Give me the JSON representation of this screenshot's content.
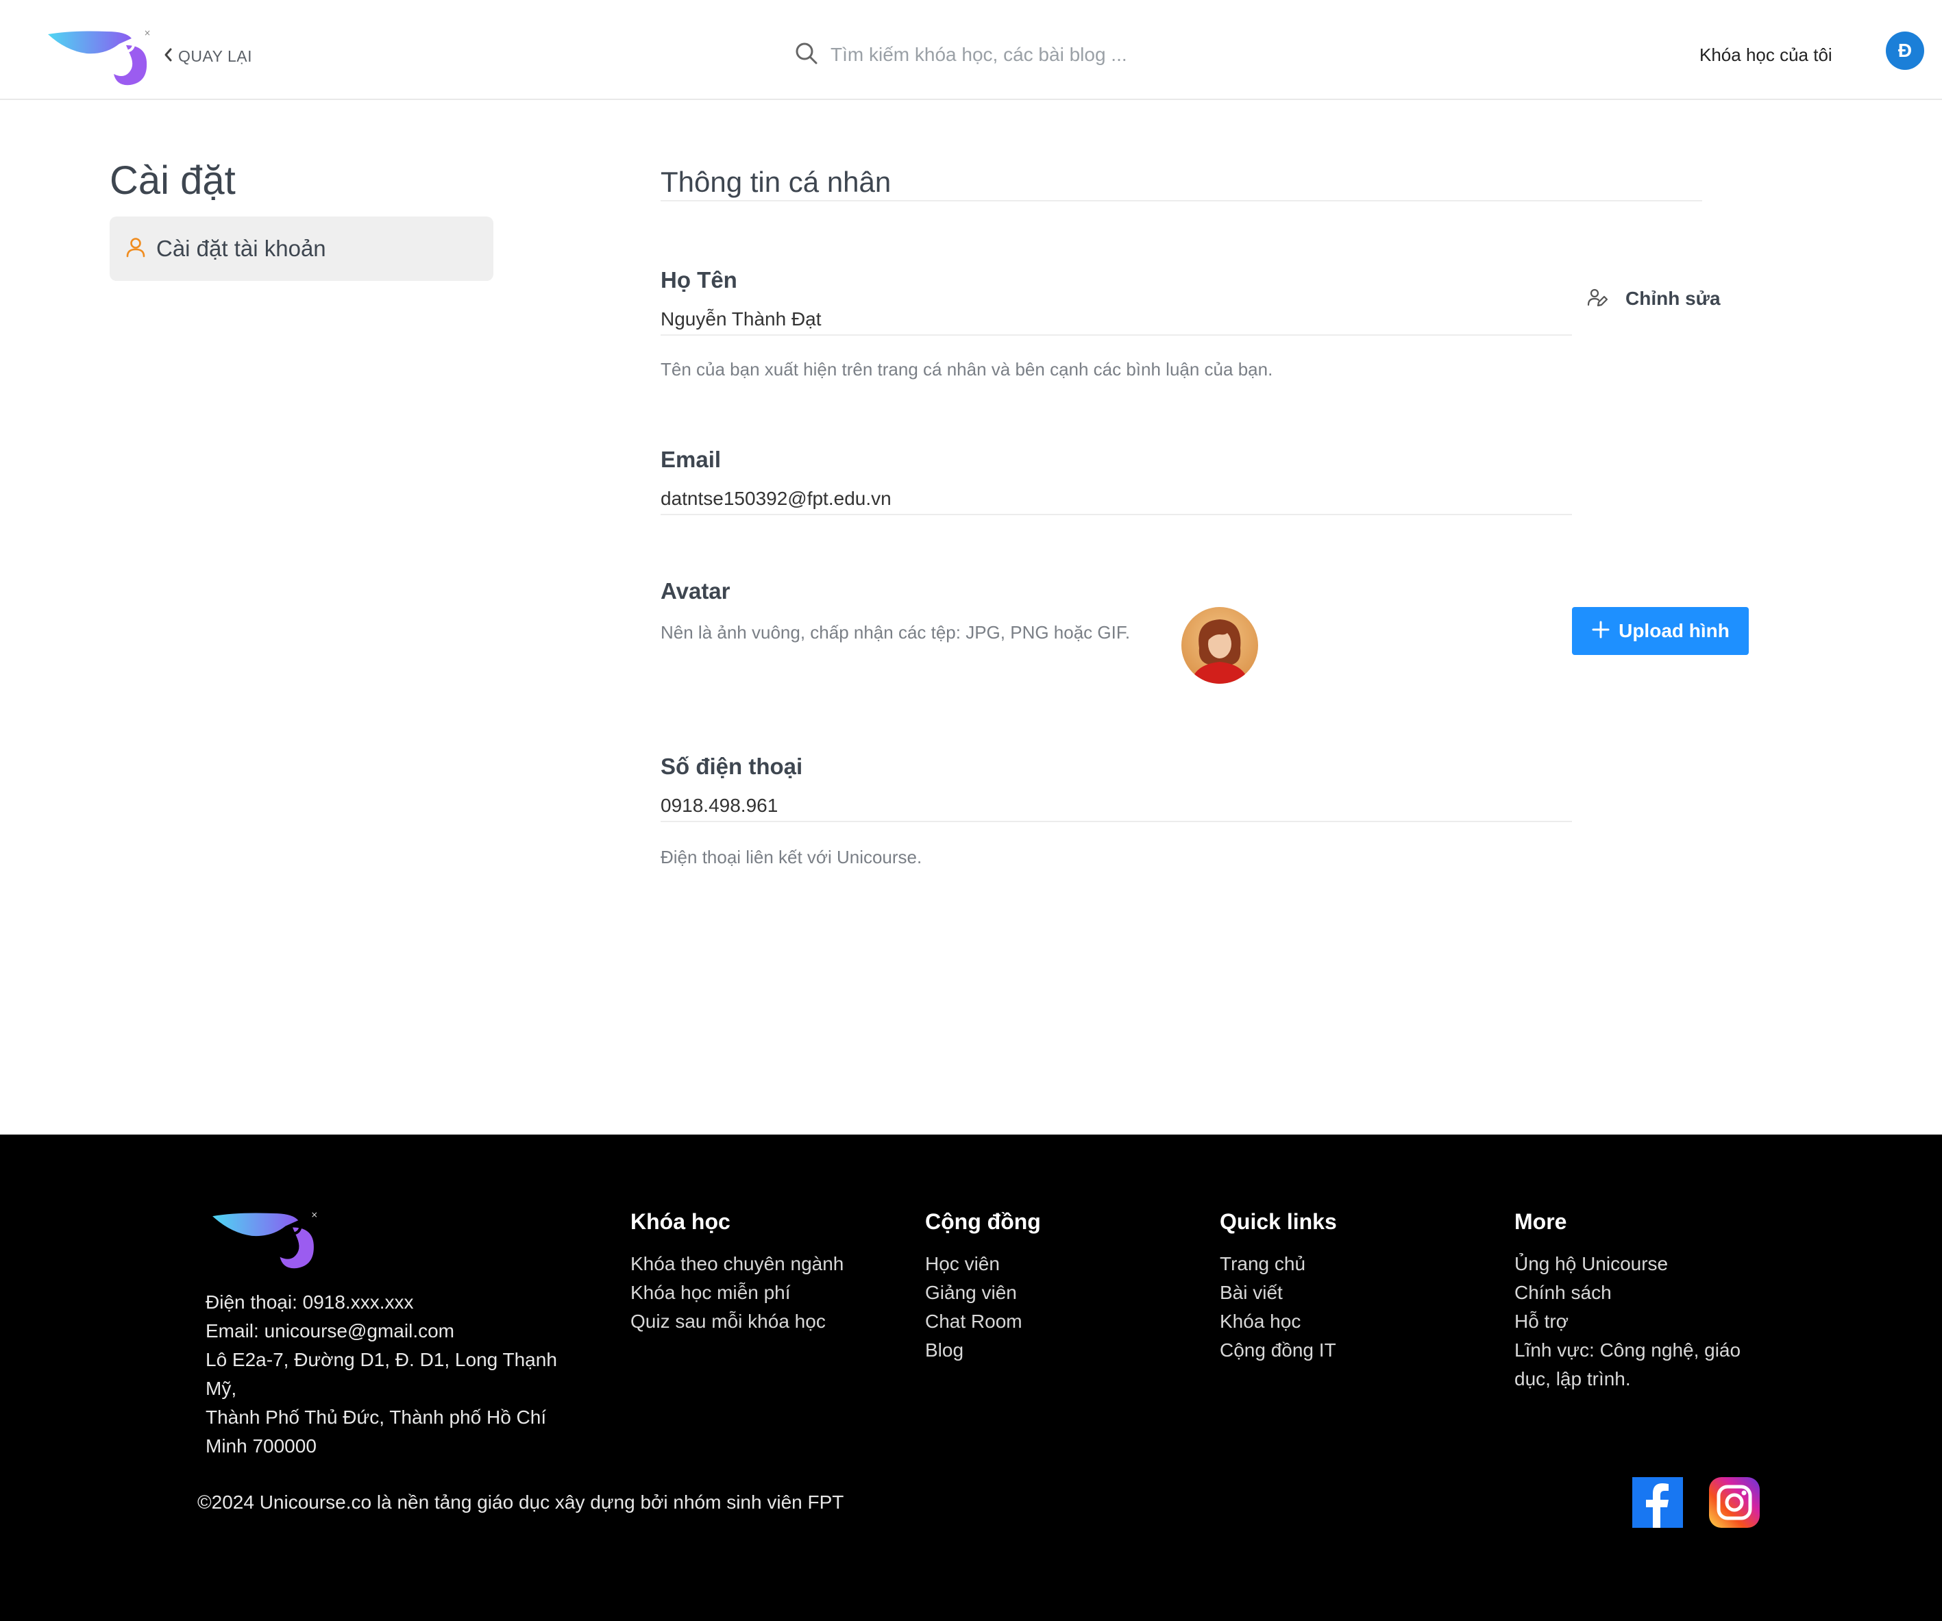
{
  "header": {
    "back_label": "QUAY LẠI",
    "search_placeholder": "Tìm kiếm khóa học, các bài blog ...",
    "my_courses": "Khóa học của tôi",
    "avatar_initial": "Đ"
  },
  "sidebar": {
    "title": "Cài đặt",
    "items": [
      {
        "label": "Cài đặt tài khoản",
        "icon": "user-icon",
        "active": true
      }
    ]
  },
  "main": {
    "section_title": "Thông tin cá nhân",
    "edit_label": "Chỉnh sửa",
    "name": {
      "label": "Họ Tên",
      "value": "Nguyễn Thành Đạt",
      "description": "Tên của bạn xuất hiện trên trang cá nhân và bên cạnh các bình luận của bạn."
    },
    "email": {
      "label": "Email",
      "value": "datntse150392@fpt.edu.vn"
    },
    "avatar": {
      "label": "Avatar",
      "description": "Nên là ảnh vuông, chấp nhận các tệp: JPG, PNG hoặc GIF.",
      "upload_label": "Upload hình"
    },
    "phone": {
      "label": "Số điện thoại",
      "value": "0918.498.961",
      "description": "Điện thoại liên kết với Unicourse."
    }
  },
  "footer": {
    "contact": {
      "phone": "Điện thoại: 0918.xxx.xxx",
      "email": "Email: unicourse@gmail.com",
      "address_lines": [
        "Lô E2a-7, Đường D1, Đ. D1, Long Thạnh Mỹ,",
        "Thành Phố Thủ Đức, Thành phố Hồ Chí",
        "Minh 700000"
      ]
    },
    "columns": [
      {
        "title": "Khóa học",
        "links": [
          "Khóa theo chuyên ngành",
          "Khóa học miễn phí",
          "Quiz sau mỗi khóa học"
        ]
      },
      {
        "title": "Cộng đồng",
        "links": [
          "Học viên",
          "Giảng viên",
          "Chat Room",
          "Blog"
        ]
      },
      {
        "title": "Quick links",
        "links": [
          "Trang chủ",
          "Bài viết",
          "Khóa học",
          "Cộng đồng IT"
        ]
      },
      {
        "title": "More",
        "links": [
          "Ủng hộ Unicourse",
          "Chính sách",
          "Hỗ trợ",
          "Lĩnh vực: Công nghệ, giáo",
          "dục, lập trình."
        ]
      }
    ],
    "copyright": "©2024 Unicourse.co là nền tảng giáo dục xây dựng bởi nhóm sinh viên FPT",
    "social": [
      "facebook-icon",
      "instagram-icon"
    ]
  },
  "colors": {
    "primary": "#1e90ff",
    "avatar_bg": "#1b7fd8",
    "sidebar_icon": "#f08c1e",
    "footer_bg": "#000000"
  }
}
